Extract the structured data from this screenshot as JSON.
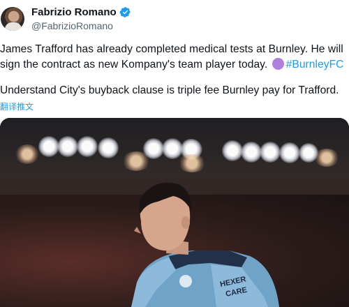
{
  "author": {
    "display_name": "Fabrizio Romano",
    "handle": "@FabrizioRomano",
    "verified": true,
    "verified_color": "#1d9bf0"
  },
  "tweet": {
    "line1": "James Trafford has already completed medical tests at Burnley. He will",
    "line2_text": "sign the contract as new Kompany's team player today.",
    "line2_emoji": "purple-circle",
    "line2_hashtag": "#BurnleyFC",
    "paragraph2": "Understand City's buyback clause is triple fee Burnley pay for Trafford.",
    "translate_label": "翻译推文"
  },
  "colors": {
    "text": "#0f1419",
    "secondary": "#536471",
    "link": "#1d9bf0",
    "emoji_purple": "#b07fdc"
  },
  "media": {
    "description_icon": "photo",
    "shirt_text": "HEXER CARE"
  }
}
